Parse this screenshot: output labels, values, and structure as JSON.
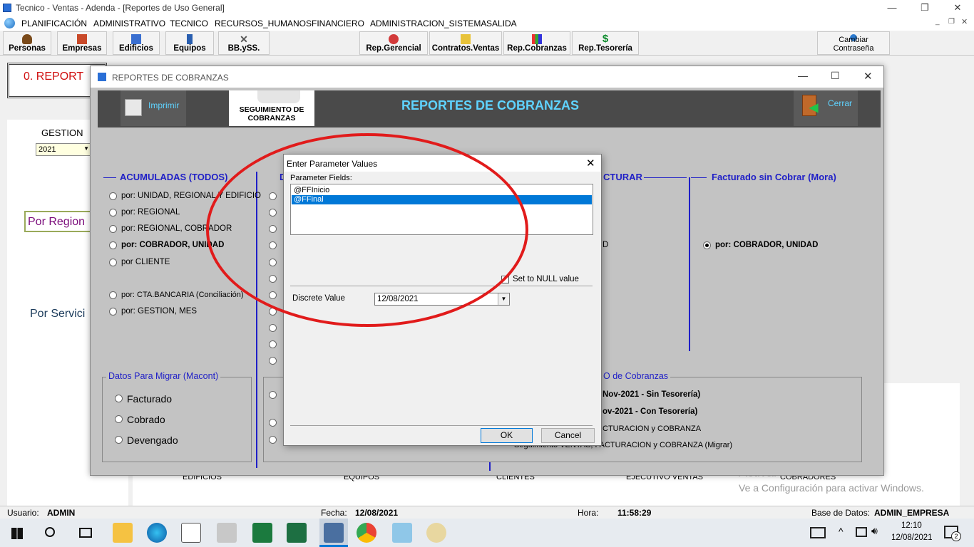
{
  "window": {
    "title": "Tecnico - Ventas - Adenda - [Reportes de Uso General]"
  },
  "menu": [
    "PLANIFICACIÓN",
    "ADMINISTRATIVO",
    "TECNICO",
    "RECURSOS_HUMANOS",
    "FINANCIERO",
    "ADMINISTRACION_SISTEMA",
    "SALIDA"
  ],
  "toolbar": {
    "left": [
      "Personas",
      "Empresas",
      "Edificios",
      "Equipos",
      "BB.ySS."
    ],
    "middle": [
      "Rep.Gerencial",
      "Contratos.Ventas",
      "Rep.Cobranzas",
      "Rep.Tesorería"
    ],
    "right": "Cambiar Contraseña"
  },
  "background": {
    "report_label": "0. REPORT",
    "gestion_label": "GESTION",
    "gestion_value": "2021",
    "por_region": "Por Region",
    "por_servicio": "Por Servici",
    "bottom_labels": [
      "EDIFICIOS",
      "EQUIPOS",
      "CLIENTES",
      "EJECUTIVO VENTAS",
      "COBRADORES"
    ],
    "watermark_title": "Activar Windows",
    "watermark_sub": "Ve a Configuración para activar Windows."
  },
  "reportes": {
    "window_title": "REPORTES DE COBRANZAS",
    "imprimir": "Imprimir",
    "seguimiento": "SEGUIMIENTO DE COBRANZAS",
    "header_title": "REPORTES DE COBRANZAS",
    "cerrar": "Cerrar",
    "group1_title": "ACUMULADAS (TODOS)",
    "group1_options": [
      "por: UNIDAD, REGIONAL Y EDIFICIO",
      "por: REGIONAL",
      "por: REGIONAL, COBRADOR",
      "por: COBRADOR, UNIDAD",
      "por CLIENTE",
      "por: CTA.BANCARIA (Conciliación)",
      "por: GESTION, MES"
    ],
    "group2_title_partial": "D",
    "group3_title_partial": "CTURAR",
    "group3_option_partial": "D",
    "group4_title": "Facturado sin Cobrar (Mora)",
    "group4_option": "por: COBRADOR, UNIDAD",
    "migrar_title": "Datos Para Migrar (Macont)",
    "migrar_options": [
      "Facturado",
      "Cobrado",
      "Devengado"
    ],
    "lower_title_partial": "O de Cobranzas",
    "lower_options": [
      "Nov-2021 - Sin Tesorería)",
      "ov-2021 - Con Tesorería)",
      "CTURACION y COBRANZA",
      "Seguimiento VENTAS, FACTURACION y COBRANZA (Migrar)"
    ]
  },
  "dialog": {
    "title": "Enter Parameter Values",
    "fields_label": "Parameter Fields:",
    "fields": [
      "@FFInicio",
      "@FFinal"
    ],
    "selected_index": 1,
    "null_label": "Set to NULL value",
    "discrete_label": "Discrete Value",
    "discrete_value": "12/08/2021",
    "ok": "OK",
    "cancel": "Cancel"
  },
  "status": {
    "usuario_label": "Usuario:",
    "usuario": "ADMIN",
    "fecha_label": "Fecha:",
    "fecha": "12/08/2021",
    "hora_label": "Hora:",
    "hora": "11:58:29",
    "base_label": "Base de Datos:",
    "base": "ADMIN_EMPRESA"
  },
  "taskbar": {
    "time": "12:10",
    "date": "12/08/2021",
    "notif_count": "2"
  },
  "colors": {
    "accent_blue": "#1f1fc7",
    "header_cyan": "#5fd3ff",
    "selection": "#0078d7",
    "annotation_red": "#e11b1b"
  }
}
